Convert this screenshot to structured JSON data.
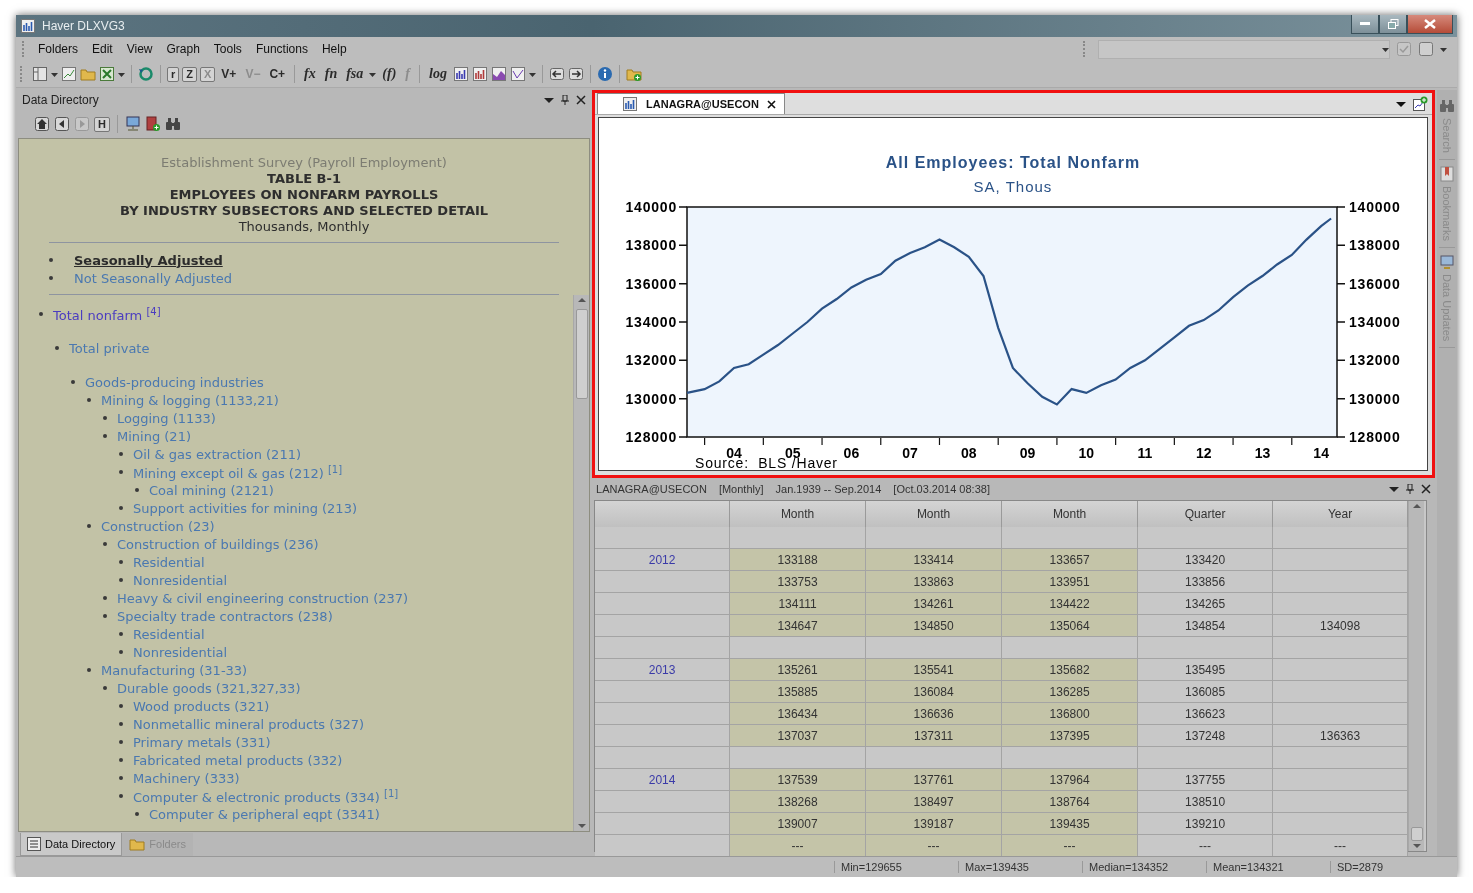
{
  "window": {
    "title": "Haver DLXVG3"
  },
  "menu": [
    "Folders",
    "Edit",
    "View",
    "Graph",
    "Tools",
    "Functions",
    "Help"
  ],
  "toolbar": {
    "text_buttons": [
      {
        "label": "r",
        "disabled": false
      },
      {
        "label": "Z",
        "disabled": false
      },
      {
        "label": "X",
        "disabled": true
      },
      {
        "label": "V+",
        "disabled": false
      },
      {
        "label": "V−",
        "disabled": true
      },
      {
        "label": "C+",
        "disabled": false
      },
      {
        "label": "fx",
        "disabled": false
      },
      {
        "label": "fn",
        "disabled": false
      },
      {
        "label": "fsa",
        "disabled": false
      },
      {
        "label": "(f)",
        "disabled": false
      },
      {
        "label": "f",
        "disabled": true
      },
      {
        "label": "log",
        "disabled": false
      }
    ]
  },
  "directory": {
    "title": "Data Directory",
    "history_button": "H",
    "heading": [
      {
        "kind": "subtitle",
        "text": "Establishment Survey (Payroll Employment)"
      },
      {
        "kind": "title",
        "text": "TABLE B-1"
      },
      {
        "kind": "title",
        "text": "EMPLOYEES ON NONFARM PAYROLLS"
      },
      {
        "kind": "title",
        "text": "BY INDUSTRY SUBSECTORS AND SELECTED DETAIL"
      },
      {
        "kind": "caption",
        "text": "Thousands, Monthly"
      }
    ],
    "adjustments": [
      {
        "label": "Seasonally Adjusted",
        "selected": true
      },
      {
        "label": "Not Seasonally Adjusted",
        "selected": false
      }
    ],
    "tree": [
      {
        "label": "Total nonfarm $^{[4]}$",
        "visited": true,
        "children": [
          {
            "label": "Total private",
            "visited": false,
            "children": [
              {
                "label": "Goods-producing industries",
                "visited": false,
                "children": [
                  {
                    "label": "Mining & logging (1133,21)",
                    "visited": false,
                    "children": [
                      {
                        "label": "Logging (1133)",
                        "visited": false
                      },
                      {
                        "label": "Mining (21)",
                        "visited": false,
                        "children": [
                          {
                            "label": "Oil & gas extraction (211)",
                            "visited": false
                          },
                          {
                            "label": "Mining except oil & gas (212) $^{[1]}$",
                            "visited": false,
                            "children": [
                              {
                                "label": "Coal mining (2121)",
                                "visited": false
                              }
                            ]
                          },
                          {
                            "label": "Support activities for mining (213)",
                            "visited": false
                          }
                        ]
                      }
                    ]
                  },
                  {
                    "label": "Construction (23)",
                    "visited": false,
                    "children": [
                      {
                        "label": "Construction of buildings (236)",
                        "visited": false,
                        "children": [
                          {
                            "label": "Residential",
                            "visited": false
                          },
                          {
                            "label": "Nonresidential",
                            "visited": false
                          }
                        ]
                      },
                      {
                        "label": "Heavy & civil engineering construction (237)",
                        "visited": false
                      },
                      {
                        "label": "Specialty trade contractors (238)",
                        "visited": false,
                        "children": [
                          {
                            "label": "Residential",
                            "visited": false
                          },
                          {
                            "label": "Nonresidential",
                            "visited": false
                          }
                        ]
                      }
                    ]
                  },
                  {
                    "label": "Manufacturing (31-33)",
                    "visited": false,
                    "children": [
                      {
                        "label": "Durable goods (321,327,33)",
                        "visited": false,
                        "children": [
                          {
                            "label": "Wood products (321)",
                            "visited": false
                          },
                          {
                            "label": "Nonmetallic mineral products (327)",
                            "visited": false
                          },
                          {
                            "label": "Primary metals (331)",
                            "visited": false
                          },
                          {
                            "label": "Fabricated metal products (332)",
                            "visited": false
                          },
                          {
                            "label": "Machinery (333)",
                            "visited": false
                          },
                          {
                            "label": "Computer & electronic products (334) $^{[1]}$",
                            "visited": false,
                            "children": [
                              {
                                "label": "Computer & peripheral eqpt (3341)",
                                "visited": false
                              }
                            ]
                          }
                        ]
                      }
                    ]
                  }
                ]
              }
            ]
          }
        ]
      }
    ],
    "tabs": [
      {
        "label": "Data Directory",
        "selected": true
      },
      {
        "label": "Folders",
        "selected": false
      }
    ]
  },
  "chart_panel": {
    "tab": "LANAGRA@USECON",
    "source": "Source:  BLS /Haver",
    "right_axis_labels": [
      "140000",
      "138000",
      "136000",
      "134000",
      "132000",
      "130000",
      "128000"
    ],
    "chart_data": {
      "type": "line",
      "title": "All Employees: Total Nonfarm",
      "subtitle": "SA, Thous",
      "x": [
        3.2,
        3.5,
        3.75,
        4.0,
        4.25,
        4.5,
        4.75,
        5.0,
        5.25,
        5.5,
        5.75,
        6.0,
        6.25,
        6.5,
        6.75,
        7.0,
        7.25,
        7.5,
        7.75,
        8.0,
        8.25,
        8.5,
        8.75,
        9.0,
        9.25,
        9.5,
        9.75,
        10.0,
        10.25,
        10.5,
        10.75,
        11.0,
        11.25,
        11.5,
        11.75,
        12.0,
        12.25,
        12.5,
        12.75,
        13.0,
        13.25,
        13.5,
        13.75,
        14.0,
        14.17
      ],
      "series": [
        {
          "color": "#2a5287",
          "values": [
            130300,
            130500,
            130900,
            131600,
            131800,
            132300,
            132800,
            133400,
            134000,
            134700,
            135200,
            135800,
            136200,
            136500,
            137200,
            137600,
            137900,
            138300,
            137900,
            137400,
            136400,
            133700,
            131600,
            130800,
            130100,
            129700,
            130500,
            130300,
            130700,
            131000,
            131600,
            132000,
            132600,
            133200,
            133800,
            134100,
            134600,
            135300,
            135900,
            136400,
            137000,
            137500,
            138300,
            139000,
            139400
          ]
        }
      ],
      "xlim": [
        3.2,
        14.27
      ],
      "ylim": [
        128000,
        140000
      ],
      "xticks": [
        {
          "value": 4,
          "label": "04"
        },
        {
          "value": 5,
          "label": "05"
        },
        {
          "value": 6,
          "label": "06"
        },
        {
          "value": 7,
          "label": "07"
        },
        {
          "value": 8,
          "label": "08"
        },
        {
          "value": 9,
          "label": "09"
        },
        {
          "value": 10,
          "label": "10"
        },
        {
          "value": 11,
          "label": "11"
        },
        {
          "value": 12,
          "label": "12"
        },
        {
          "value": 13,
          "label": "13"
        },
        {
          "value": 14,
          "label": "14"
        }
      ],
      "yticks": [
        128000,
        130000,
        132000,
        134000,
        136000,
        138000,
        140000
      ]
    }
  },
  "data_panel": {
    "header": [
      "LANAGRA@USECON",
      "[Monthly]",
      "Jan.1939 -- Sep.2014",
      "[Oct.03.2014 08:38]"
    ],
    "columns": [
      "Month",
      "Month",
      "Month",
      "Quarter",
      "Year"
    ],
    "rows": [
      {
        "kind": "spacer"
      },
      {
        "kind": "data",
        "label": "2012",
        "months": [
          "133188",
          "133414",
          "133657"
        ],
        "quarter": "133420"
      },
      {
        "kind": "data",
        "months": [
          "133753",
          "133863",
          "133951"
        ],
        "quarter": "133856"
      },
      {
        "kind": "data",
        "months": [
          "134111",
          "134261",
          "134422"
        ],
        "quarter": "134265"
      },
      {
        "kind": "data",
        "months": [
          "134647",
          "134850",
          "135064"
        ],
        "quarter": "134854",
        "year": "134098"
      },
      {
        "kind": "spacer"
      },
      {
        "kind": "data",
        "label": "2013",
        "months": [
          "135261",
          "135541",
          "135682"
        ],
        "quarter": "135495"
      },
      {
        "kind": "data",
        "months": [
          "135885",
          "136084",
          "136285"
        ],
        "quarter": "136085"
      },
      {
        "kind": "data",
        "months": [
          "136434",
          "136636",
          "136800"
        ],
        "quarter": "136623"
      },
      {
        "kind": "data",
        "months": [
          "137037",
          "137311",
          "137395"
        ],
        "quarter": "137248",
        "year": "136363"
      },
      {
        "kind": "spacer"
      },
      {
        "kind": "data",
        "label": "2014",
        "months": [
          "137539",
          "137761",
          "137964"
        ],
        "quarter": "137755"
      },
      {
        "kind": "data",
        "months": [
          "138268",
          "138497",
          "138764"
        ],
        "quarter": "138510"
      },
      {
        "kind": "data",
        "months": [
          "139007",
          "139187",
          "139435"
        ],
        "quarter": "139210"
      },
      {
        "kind": "data",
        "months": [
          "---",
          "---",
          "---"
        ],
        "quarter": "---",
        "year": "---"
      }
    ]
  },
  "side_tabs": [
    "Search",
    "Bookmarks",
    "Data Updates"
  ],
  "status_bar": [
    "Min=129655",
    "Max=139435",
    "Median=134352",
    "Mean=134321",
    "SD=2879"
  ]
}
